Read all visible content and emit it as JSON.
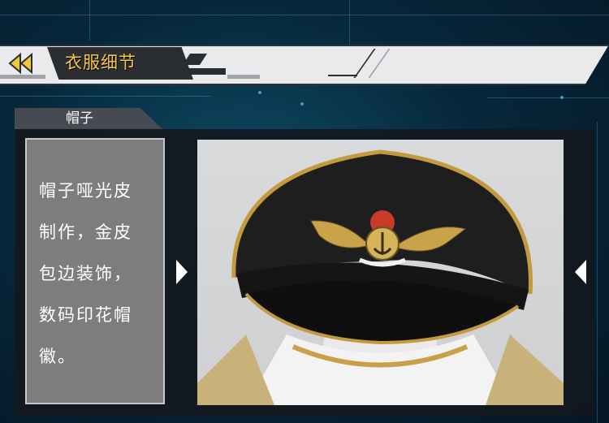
{
  "header": {
    "title": "衣服细节",
    "back_icon": "double-chevron-left-icon",
    "accent_color": "#f7c74a"
  },
  "section": {
    "label": "帽子"
  },
  "description": {
    "lines": [
      "帽子哑光皮",
      "制作，金皮",
      "包边装饰，",
      "数码印花帽",
      "徽。"
    ]
  },
  "carousel": {
    "prev_icon": "triangle-right-icon",
    "next_icon": "triangle-left-icon"
  },
  "photo": {
    "subject_icon": "military-cap-image"
  }
}
